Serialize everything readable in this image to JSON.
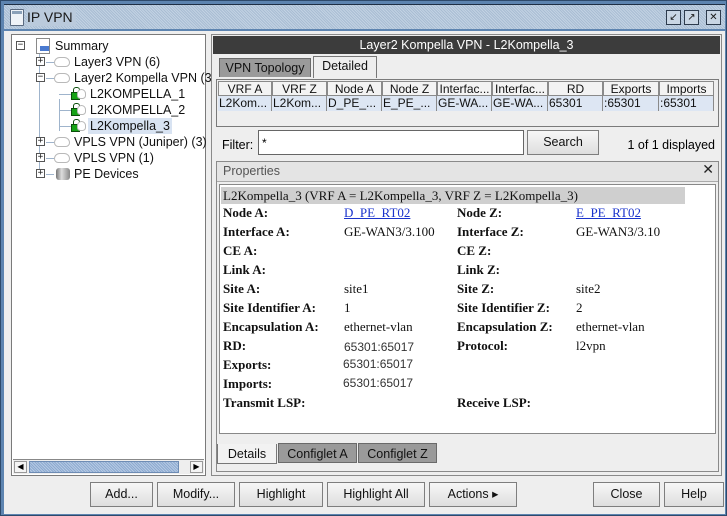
{
  "window": {
    "title": "IP VPN",
    "controls": [
      "minimize-icon",
      "maximize-icon",
      "close-icon"
    ]
  },
  "tree": {
    "items": [
      {
        "label": "Summary",
        "icon": "summary-doc-icon",
        "expander": "−",
        "level": 0
      },
      {
        "label": "Layer3 VPN (6)",
        "icon": "cloud-icon",
        "expander": "+",
        "level": 1
      },
      {
        "label": "Layer2 Kompella VPN (3",
        "icon": "cloud-icon",
        "expander": "−",
        "level": 1
      },
      {
        "label": "L2KOMPELLA_1",
        "icon": "lock-cloud-icon",
        "level": 2
      },
      {
        "label": "L2KOMPELLA_2",
        "icon": "lock-cloud-icon",
        "level": 2
      },
      {
        "label": "L2Kompella_3",
        "icon": "lock-cloud-icon",
        "level": 2,
        "selected": true
      },
      {
        "label": "VPLS VPN (Juniper) (3)",
        "icon": "cloud-icon",
        "expander": "+",
        "level": 1
      },
      {
        "label": "VPLS VPN (1)",
        "icon": "cloud-icon",
        "expander": "+",
        "level": 1
      },
      {
        "label": "PE Devices",
        "icon": "database-icon",
        "expander": "+",
        "level": 1
      }
    ]
  },
  "detail": {
    "header": "Layer2 Kompella VPN - L2Kompella_3",
    "tabs": [
      {
        "label": "VPN Topology",
        "active": false
      },
      {
        "label": "Detailed",
        "active": true
      }
    ],
    "table": {
      "columns": [
        "VRF A",
        "VRF Z",
        "Node A",
        "Node Z",
        "Interfac...",
        "Interfac...",
        "RD",
        "Exports",
        "Imports"
      ],
      "rows": [
        [
          "L2Kom...",
          "L2Kom...",
          "D_PE_...",
          "E_PE_...",
          "GE-WA...",
          "GE-WA...",
          "65301",
          ":65301",
          ":65301"
        ]
      ]
    },
    "filter": {
      "label": "Filter:",
      "value": "*",
      "search_label": "Search",
      "count_text": "1 of 1 displayed"
    }
  },
  "properties": {
    "panel_title": "Properties",
    "close_glyph": "✕",
    "title": "L2Kompella_3   (VRF A = L2Kompella_3, VRF Z = L2Kompella_3)",
    "left": [
      {
        "label": "Node A:",
        "value": "D_PE_RT02",
        "link": true
      },
      {
        "label": "Interface A:",
        "value": "GE-WAN3/3.100"
      },
      {
        "label": "CE A:",
        "value": ""
      },
      {
        "label": "Link A:",
        "value": ""
      },
      {
        "label": "Site A:",
        "value": "site1"
      },
      {
        "label": "Site Identifier A:",
        "value": "1"
      },
      {
        "label": "Encapsulation A:",
        "value": "ethernet-vlan"
      },
      {
        "label": "RD:",
        "value": "65301:65017",
        "sans": true
      },
      {
        "label": "Exports:",
        "value": "65301:65017",
        "sans": true
      },
      {
        "label": "Imports:",
        "value": "65301:65017",
        "sans": true
      },
      {
        "label": "Transmit LSP:",
        "value": ""
      }
    ],
    "right": [
      {
        "label": "Node Z:",
        "value": "E_PE_RT02",
        "link": true
      },
      {
        "label": "Interface Z:",
        "value": "GE-WAN3/3.10"
      },
      {
        "label": "CE Z:",
        "value": ""
      },
      {
        "label": "Link Z:",
        "value": ""
      },
      {
        "label": "Site Z:",
        "value": "site2"
      },
      {
        "label": "Site Identifier Z:",
        "value": "2"
      },
      {
        "label": "Encapsulation Z:",
        "value": "ethernet-vlan"
      },
      {
        "label": "Protocol:",
        "value": "l2vpn"
      },
      {
        "label": "",
        "value": ""
      },
      {
        "label": "",
        "value": ""
      },
      {
        "label": "Receive LSP:",
        "value": ""
      }
    ],
    "bottom_tabs": [
      {
        "label": "Details",
        "active": true
      },
      {
        "label": "Configlet A",
        "active": false
      },
      {
        "label": "Configlet Z",
        "active": false
      }
    ]
  },
  "buttons": {
    "add": "Add...",
    "modify": "Modify...",
    "highlight": "Highlight",
    "highlight_all": "Highlight All",
    "actions": "Actions ▸",
    "close": "Close",
    "help": "Help"
  }
}
